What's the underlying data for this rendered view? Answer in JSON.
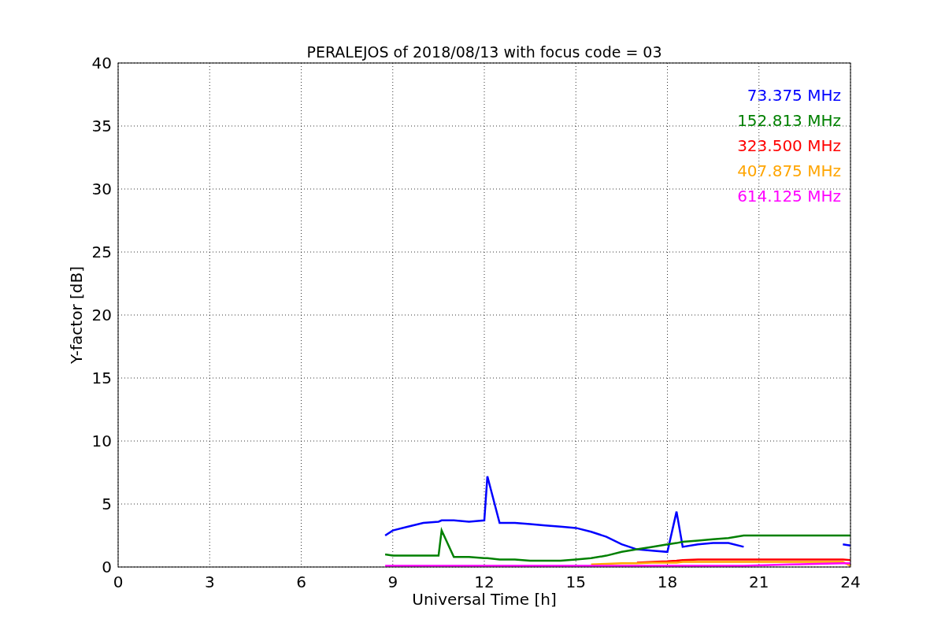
{
  "chart_data": {
    "type": "line",
    "title": "PERALEJOS of 2018/08/13 with focus code = 03",
    "xlabel": "Universal Time [h]",
    "ylabel": "Y-factor [dB]",
    "x": [
      8.75,
      9,
      9.5,
      10,
      10.5,
      10.6,
      11,
      11.5,
      12,
      12.1,
      12.5,
      13,
      13.5,
      14,
      14.5,
      15,
      15.5,
      16,
      16.5,
      17,
      17.5,
      18,
      18.3,
      18.5,
      19,
      19.5,
      20,
      20.5,
      22,
      23.75,
      24
    ],
    "series": [
      {
        "name": "73.375 MHz",
        "color": "#0000ff",
        "values": [
          2.5,
          2.9,
          3.2,
          3.5,
          3.6,
          3.7,
          3.7,
          3.6,
          3.7,
          7.2,
          3.5,
          3.5,
          3.4,
          3.3,
          3.2,
          3.1,
          2.8,
          2.4,
          1.8,
          1.4,
          1.3,
          1.2,
          4.4,
          1.6,
          1.8,
          1.9,
          1.9,
          1.6,
          null,
          1.8,
          1.7
        ]
      },
      {
        "name": "152.813 MHz",
        "color": "#008000",
        "values": [
          1.0,
          0.9,
          0.9,
          0.9,
          0.9,
          2.9,
          0.8,
          0.8,
          0.7,
          0.7,
          0.6,
          0.6,
          0.5,
          0.5,
          0.5,
          0.6,
          0.7,
          0.9,
          1.2,
          1.4,
          1.6,
          1.8,
          1.9,
          2.0,
          2.1,
          2.2,
          2.3,
          2.5,
          2.5,
          2.5,
          2.5
        ]
      },
      {
        "name": "323.500 MHz",
        "color": "#ff0000",
        "values": [
          null,
          null,
          null,
          null,
          null,
          null,
          null,
          null,
          null,
          null,
          null,
          null,
          null,
          null,
          null,
          null,
          null,
          null,
          null,
          0.35,
          0.4,
          0.45,
          0.5,
          0.55,
          0.6,
          0.6,
          0.6,
          0.6,
          0.6,
          0.6,
          0.55
        ]
      },
      {
        "name": "407.875 MHz",
        "color": "#ffa500",
        "values": [
          null,
          null,
          null,
          null,
          null,
          null,
          null,
          null,
          null,
          null,
          null,
          null,
          null,
          null,
          null,
          null,
          0.2,
          0.25,
          0.3,
          0.3,
          0.35,
          0.35,
          0.35,
          0.4,
          0.4,
          0.4,
          0.4,
          0.4,
          0.4,
          0.4,
          0.1
        ]
      },
      {
        "name": "614.125 MHz",
        "color": "#ff00ff",
        "values": [
          0.1,
          0.1,
          0.1,
          0.1,
          0.1,
          0.1,
          0.1,
          0.1,
          0.1,
          0.1,
          0.1,
          0.1,
          0.1,
          0.1,
          0.1,
          0.1,
          0.1,
          0.1,
          0.1,
          0.1,
          0.1,
          0.1,
          0.1,
          0.1,
          0.1,
          0.1,
          0.1,
          0.1,
          0.2,
          0.3,
          0.3
        ]
      }
    ],
    "xlim": [
      0,
      24
    ],
    "ylim": [
      0,
      40
    ],
    "xticks": [
      0,
      3,
      6,
      9,
      12,
      15,
      18,
      21,
      24
    ],
    "yticks": [
      0,
      5,
      10,
      15,
      20,
      25,
      30,
      35,
      40
    ],
    "grid": true
  }
}
